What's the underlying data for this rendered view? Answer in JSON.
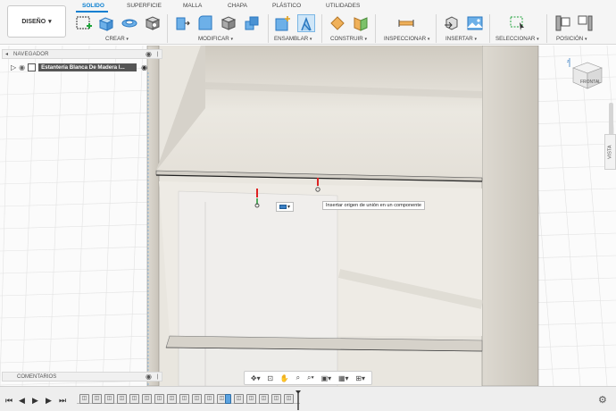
{
  "toolbar": {
    "workspace": "DISEÑO",
    "tabs": [
      "SOLIDO",
      "SUPERFICIE",
      "MALLA",
      "CHAPA",
      "PLÁSTICO",
      "UTILIDADES"
    ],
    "groups": {
      "crear": "CREAR",
      "modificar": "MODIFICAR",
      "ensamblar": "ENSAMBLAR",
      "construir": "CONSTRUIR",
      "inspeccionar": "INSPECCIONAR",
      "insertar": "INSERTAR",
      "seleccionar": "SELECCIONAR",
      "posicion": "POSICIÓN"
    }
  },
  "browser": {
    "title": "NAVEGADOR",
    "root_item": "Estantería Blanca De Madera I...",
    "comments": "COMENTARIOS"
  },
  "viewcube": {
    "face": "FRONTAL"
  },
  "side_panel": {
    "label": "VISTA"
  },
  "tooltip": {
    "text": "Insertar origen de unión en un componente"
  },
  "colors": {
    "accent": "#0a7fd1",
    "model_surface": "#e6e2da",
    "grid_line": "#dddddd"
  }
}
